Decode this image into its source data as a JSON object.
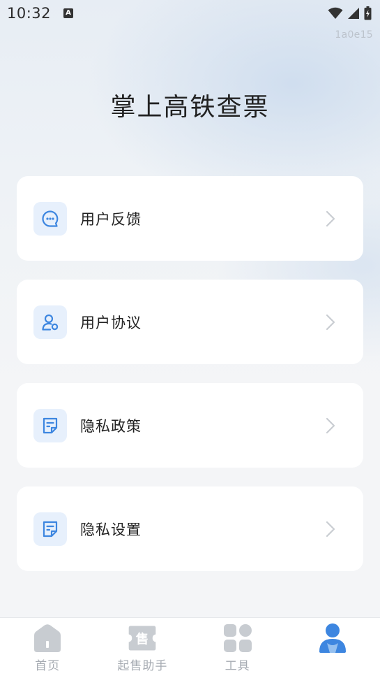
{
  "status_bar": {
    "time": "10:32",
    "badge": "A"
  },
  "version": "1a0e15",
  "page": {
    "title": "掌上高铁查票"
  },
  "menu": {
    "items": [
      {
        "label": "用户反馈",
        "icon": "chat-bubble-icon"
      },
      {
        "label": "用户协议",
        "icon": "user-settings-icon"
      },
      {
        "label": "隐私政策",
        "icon": "document-icon"
      },
      {
        "label": "隐私设置",
        "icon": "document-icon"
      }
    ]
  },
  "tabbar": {
    "tabs": [
      {
        "label": "首页",
        "icon": "home-icon",
        "active": false
      },
      {
        "label": "起售助手",
        "icon": "ticket-icon",
        "active": false,
        "icon_text": "售"
      },
      {
        "label": "工具",
        "icon": "grid-icon",
        "active": false
      },
      {
        "label": "",
        "icon": "user-icon",
        "active": true
      }
    ]
  },
  "colors": {
    "accent": "#3d86e0",
    "icon_bg": "#e7f0fc",
    "tab_inactive": "#c8ccd1"
  }
}
